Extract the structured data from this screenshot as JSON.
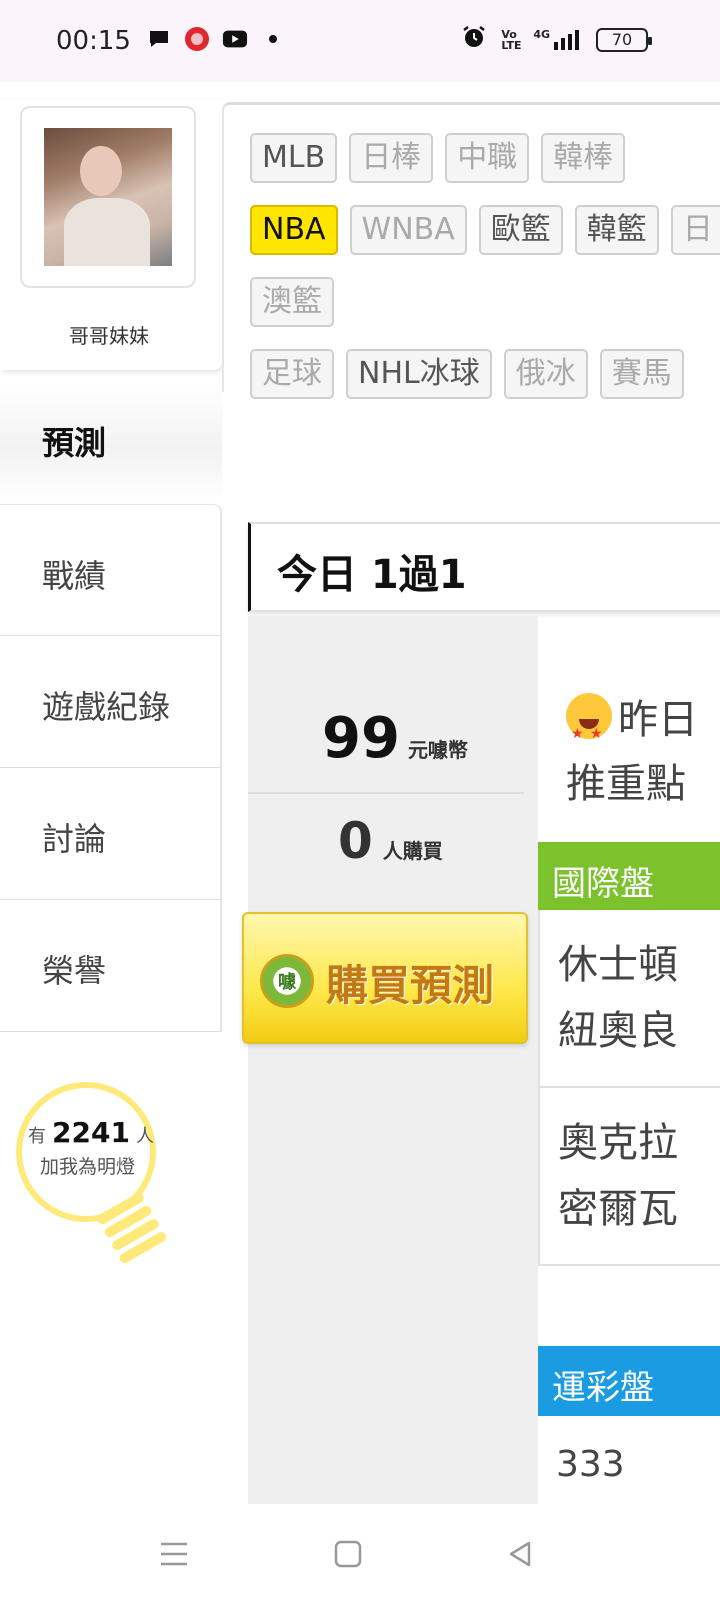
{
  "status_bar": {
    "time": "00:15",
    "battery": "70",
    "left_icons": [
      "message-icon",
      "app-icon",
      "youtube-icon",
      "dot-icon"
    ],
    "right_icons": [
      "alarm-icon",
      "volte-icon",
      "signal-4g-icon"
    ],
    "volte_label": "Vo LTE",
    "network_label": "4G"
  },
  "profile": {
    "username": "哥哥妹妹"
  },
  "sidebar": {
    "active_item": "預測",
    "items": [
      {
        "label": "戰績"
      },
      {
        "label": "遊戲紀錄"
      },
      {
        "label": "討論"
      },
      {
        "label": "榮譽"
      }
    ],
    "fans": {
      "prefix": "有",
      "count": "2241",
      "suffix": "人",
      "caption": "加我為明燈"
    }
  },
  "filters": {
    "rows": [
      [
        {
          "label": "MLB",
          "state": "available"
        },
        {
          "label": "日棒",
          "state": "disabled"
        },
        {
          "label": "中職",
          "state": "disabled"
        },
        {
          "label": "韓棒",
          "state": "disabled"
        }
      ],
      [
        {
          "label": "NBA",
          "state": "selected"
        },
        {
          "label": "WNBA",
          "state": "disabled"
        },
        {
          "label": "歐籃",
          "state": "available"
        },
        {
          "label": "韓籃",
          "state": "available"
        },
        {
          "label": "日",
          "state": "disabled"
        }
      ],
      [
        {
          "label": "澳籃",
          "state": "disabled"
        }
      ],
      [
        {
          "label": "足球",
          "state": "disabled"
        },
        {
          "label": "NHL冰球",
          "state": "available"
        },
        {
          "label": "俄冰",
          "state": "disabled"
        },
        {
          "label": "賽馬",
          "state": "disabled"
        }
      ]
    ]
  },
  "section": {
    "title": "今日 1過1"
  },
  "purchase": {
    "price": "99",
    "price_unit": "元噱幣",
    "buyers": "0",
    "buyers_unit": "人購買",
    "logo_text": "噱",
    "button_label": "購買預測"
  },
  "detail": {
    "promo_line1": "昨日",
    "promo_line2": "推重點",
    "intl_header": "國際盤",
    "matches": [
      {
        "line1": "休士頓",
        "line2": "紐奧良"
      },
      {
        "line1": "奧克拉",
        "line2": "密爾瓦"
      }
    ],
    "lottery_header": "運彩盤",
    "lottery_number": "333"
  },
  "colors": {
    "selected_chip": "#ffe600",
    "intl_header": "#7bc22c",
    "lottery_header": "#1a9be2",
    "bulb": "#ffe97a"
  }
}
